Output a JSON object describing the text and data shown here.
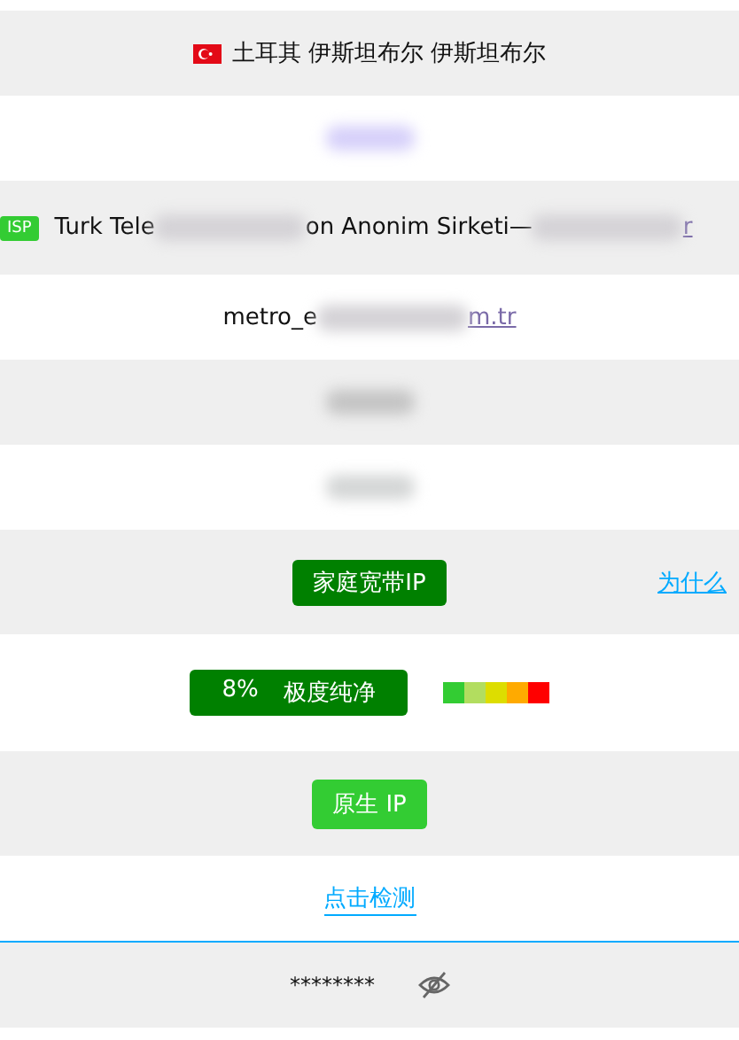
{
  "rows": [
    {
      "kind": "location",
      "text": "土耳其 伊斯坦布尔 伊斯坦布尔"
    },
    {
      "kind": "blurred",
      "color": "#d6d0fa"
    },
    {
      "kind": "isp",
      "badge": "ISP",
      "parts": [
        {
          "kind": "text",
          "text": "Turk Tele"
        },
        {
          "kind": "blur"
        },
        {
          "kind": "text",
          "text": "on Anonim Sirketi—"
        },
        {
          "kind": "blur"
        },
        {
          "kind": "link",
          "text": "r"
        }
      ]
    },
    {
      "kind": "segments",
      "parts": [
        {
          "kind": "text",
          "text": "metro_e"
        },
        {
          "kind": "blur"
        },
        {
          "kind": "link",
          "text": "m.tr"
        }
      ]
    },
    {
      "kind": "blurred",
      "color": "#c4c4c4"
    },
    {
      "kind": "blurred",
      "color": "#d4d6d6"
    },
    {
      "kind": "type",
      "badge": "家庭宽带IP",
      "link": "为什么"
    },
    {
      "kind": "score",
      "percent": "8%",
      "label": "极度纯净",
      "scale": [
        {
          "color": "#33cc33"
        },
        {
          "color": "#b2dd5f"
        },
        {
          "color": "#dddd00"
        },
        {
          "color": "#ffaa00"
        },
        {
          "color": "#ff0000"
        }
      ]
    },
    {
      "kind": "native",
      "badge": "原生 IP"
    },
    {
      "kind": "check",
      "link": "点击检测"
    },
    {
      "kind": "password",
      "value": "********",
      "revealed": false
    }
  ]
}
